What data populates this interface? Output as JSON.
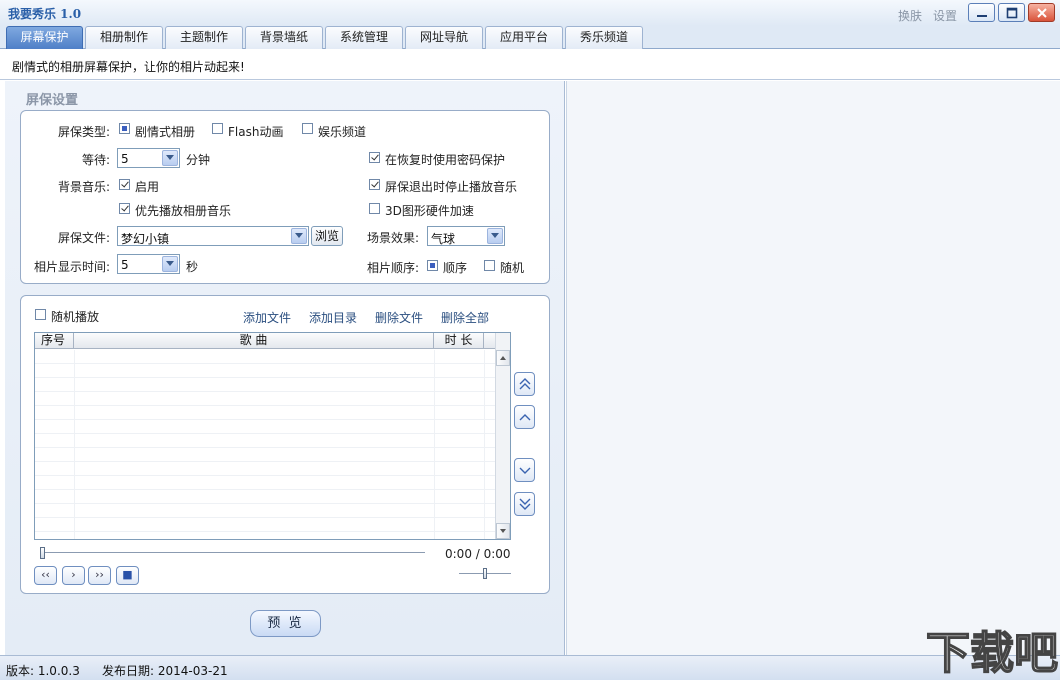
{
  "window": {
    "title": "我要秀乐 1.0",
    "skin_label": "换肤",
    "settings_label": "设置"
  },
  "tabs": [
    {
      "label": "屏幕保护",
      "active": true
    },
    {
      "label": "相册制作",
      "active": false
    },
    {
      "label": "主题制作",
      "active": false
    },
    {
      "label": "背景墙纸",
      "active": false
    },
    {
      "label": "系统管理",
      "active": false
    },
    {
      "label": "网址导航",
      "active": false
    },
    {
      "label": "应用平台",
      "active": false
    },
    {
      "label": "秀乐频道",
      "active": false
    }
  ],
  "subtitle": "剧情式的相册屏幕保护，让你的相片动起来!",
  "section_title": "屏保设置",
  "settings": {
    "type_label": "屏保类型:",
    "type_options": [
      {
        "label": "剧情式相册",
        "selected": true
      },
      {
        "label": "Flash动画",
        "selected": false
      },
      {
        "label": "娱乐频道",
        "selected": false
      }
    ],
    "wait_label": "等待:",
    "wait_value": "5",
    "wait_unit": "分钟",
    "password_label": "在恢复时使用密码保护",
    "password_checked": true,
    "bgmusic_label": "背景音乐:",
    "enable_label": "启用",
    "enable_checked": true,
    "stopmusic_label": "屏保退出时停止播放音乐",
    "stopmusic_checked": true,
    "prefer_label": "优先播放相册音乐",
    "prefer_checked": true,
    "accel_label": "3D图形硬件加速",
    "accel_checked": false,
    "file_label": "屏保文件:",
    "file_value": "梦幻小镇",
    "browse_label": "浏览",
    "effect_label": "场景效果:",
    "effect_value": "气球",
    "photo_time_label": "相片显示时间:",
    "photo_time_value": "5",
    "photo_time_unit": "秒",
    "order_label": "相片顺序:",
    "order_options": [
      {
        "label": "顺序",
        "selected": true
      },
      {
        "label": "随机",
        "selected": false
      }
    ]
  },
  "playlist": {
    "random_label": "随机播放",
    "random_checked": false,
    "actions": [
      "添加文件",
      "添加目录",
      "删除文件",
      "删除全部"
    ],
    "columns": [
      "序号",
      "歌 曲",
      "时 长"
    ],
    "rows": [],
    "time_display": "0:00 / 0:00",
    "progress": 0,
    "volume": 0.5
  },
  "player_buttons": [
    "‹‹",
    "›",
    "››",
    "■"
  ],
  "preview_label": "预 览",
  "status": {
    "version": "版本: 1.0.0.3",
    "release_date": "发布日期: 2014-03-21"
  },
  "watermark_text": "下载吧"
}
